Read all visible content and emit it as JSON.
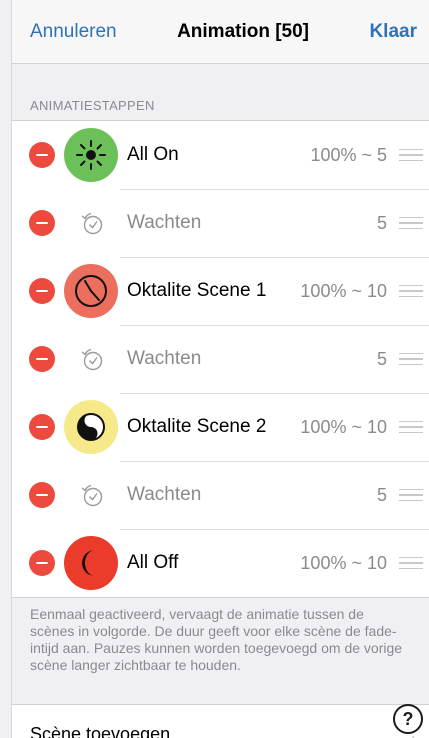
{
  "nav": {
    "cancel_label": "Annuleren",
    "title": "Animation [50]",
    "done_label": "Klaar"
  },
  "section_header": "ANIMATIESTAPPEN",
  "steps": [
    {
      "label": "All On",
      "value": "100% ~ 5",
      "icon": "sun-icon",
      "kind": "scene"
    },
    {
      "label": "Wachten",
      "value": "5",
      "icon": "wait-timer-icon",
      "kind": "wait"
    },
    {
      "label": "Oktalite Scene 1",
      "value": "100% ~ 10",
      "icon": "clock-icon",
      "kind": "scene"
    },
    {
      "label": "Wachten",
      "value": "5",
      "icon": "wait-timer-icon",
      "kind": "wait"
    },
    {
      "label": "Oktalite Scene 2",
      "value": "100% ~ 10",
      "icon": "yin-yang-icon",
      "kind": "scene"
    },
    {
      "label": "Wachten",
      "value": "5",
      "icon": "wait-timer-icon",
      "kind": "wait"
    },
    {
      "label": "All Off",
      "value": "100% ~ 10",
      "icon": "moon-icon",
      "kind": "scene"
    }
  ],
  "footer_note": "Eenmaal geactiveerd, vervaagt de animatie tussen de scènes in volgorde. De duur geeft voor elke scène de fade-intijd aan. Pauzes kunnen worden toegevoegd om de vorige scène langer zichtbaar te houden.",
  "add_scene_label": "Scène toevoegen",
  "help_label": "?",
  "colors": {
    "accent": "#2e72b8",
    "delete": "#ec4a3e",
    "all_on": "#6cc05a",
    "scene1": "#ec6e5c",
    "scene2": "#f5e98a",
    "all_off": "#eb3b2b"
  }
}
